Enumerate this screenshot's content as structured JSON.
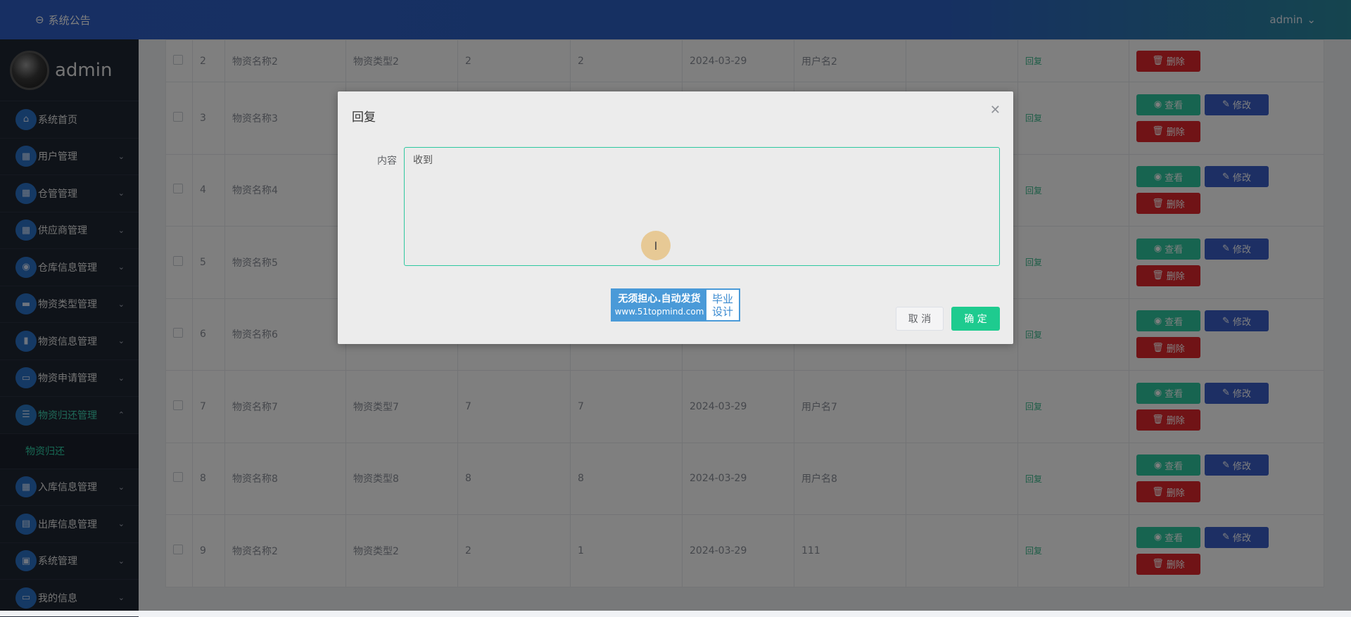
{
  "header": {
    "notice_icon": "info-circle-icon",
    "notice_label": "系统公告",
    "user_label": "admin"
  },
  "sidebar": {
    "username": "admin",
    "items": [
      {
        "label": "系统首页",
        "icon": "home-icon"
      },
      {
        "label": "用户管理",
        "icon": "grid-icon"
      },
      {
        "label": "仓管管理",
        "icon": "grid-icon"
      },
      {
        "label": "供应商管理",
        "icon": "grid-icon"
      },
      {
        "label": "仓库信息管理",
        "icon": "location-icon"
      },
      {
        "label": "物资类型管理",
        "icon": "chat-icon"
      },
      {
        "label": "物资信息管理",
        "icon": "document-icon"
      },
      {
        "label": "物资申请管理",
        "icon": "monitor-icon"
      },
      {
        "label": "物资归还管理",
        "icon": "list-icon"
      },
      {
        "label": "入库信息管理",
        "icon": "grid-icon"
      },
      {
        "label": "出库信息管理",
        "icon": "ticket-icon"
      },
      {
        "label": "系统管理",
        "icon": "clipboard-icon"
      },
      {
        "label": "我的信息",
        "icon": "card-icon"
      }
    ],
    "submenu_label": "物资归还"
  },
  "table": {
    "rows": [
      {
        "no": "2",
        "name": "物资名称2",
        "type": "物资类型2",
        "qty": "2",
        "ret": "2",
        "date": "2024-03-29",
        "user": "用户名2",
        "reply": "回复"
      },
      {
        "no": "3",
        "name": "物资名称3",
        "type": "",
        "qty": "",
        "ret": "",
        "date": "",
        "user": "",
        "reply": "回复"
      },
      {
        "no": "4",
        "name": "物资名称4",
        "type": "",
        "qty": "",
        "ret": "",
        "date": "",
        "user": "",
        "reply": "回复"
      },
      {
        "no": "5",
        "name": "物资名称5",
        "type": "",
        "qty": "",
        "ret": "",
        "date": "",
        "user": "",
        "reply": "回复"
      },
      {
        "no": "6",
        "name": "物资名称6",
        "type": "",
        "qty": "",
        "ret": "",
        "date": "",
        "user": "",
        "reply": "回复"
      },
      {
        "no": "7",
        "name": "物资名称7",
        "type": "物资类型7",
        "qty": "7",
        "ret": "7",
        "date": "2024-03-29",
        "user": "用户名7",
        "reply": "回复"
      },
      {
        "no": "8",
        "name": "物资名称8",
        "type": "物资类型8",
        "qty": "8",
        "ret": "8",
        "date": "2024-03-29",
        "user": "用户名8",
        "reply": "回复"
      },
      {
        "no": "9",
        "name": "物资名称2",
        "type": "物资类型2",
        "qty": "2",
        "ret": "1",
        "date": "2024-03-29",
        "user": "111",
        "reply": "回复"
      }
    ],
    "view_label": "查看",
    "edit_label": "修改",
    "delete_label": "删除"
  },
  "dialog": {
    "title": "回复",
    "field_label": "内容",
    "content_value": "收到",
    "cancel_label": "取 消",
    "confirm_label": "确 定"
  },
  "watermark": {
    "line1": "无须担心.自动发货",
    "line2": "www.51topmind.com",
    "right1": "毕业",
    "right2": "设计"
  },
  "colors": {
    "accent": "#1ecb8f",
    "primary": "#2f5fc7",
    "danger": "#e0262d",
    "edit": "#3a5ec8"
  }
}
